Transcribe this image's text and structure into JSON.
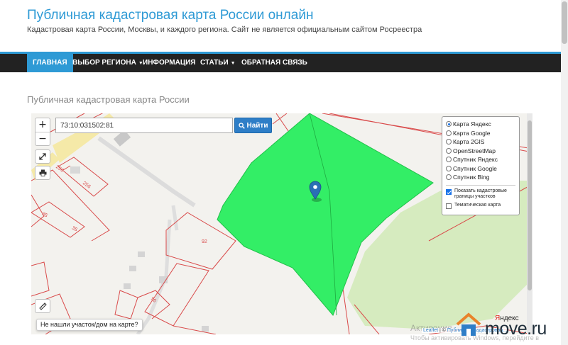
{
  "header": {
    "title": "Публичная кадастровая карта России онлайн",
    "description": "Кадастровая карта России, Москвы, и каждого региона. Сайт не является официальным сайтом Росреестра"
  },
  "nav": {
    "items": [
      {
        "label": "ГЛАВНАЯ",
        "active": true
      },
      {
        "label": "ВЫБОР РЕГИОНА",
        "dropdown": true
      },
      {
        "label": "ИНФОРМАЦИЯ"
      },
      {
        "label": "СТАТЬИ",
        "dropdown": true
      },
      {
        "label": "ОБРАТНАЯ СВЯЗЬ"
      }
    ]
  },
  "section_title": "Публичная кадастровая карта России",
  "map": {
    "zoom_in": "+",
    "zoom_out": "−",
    "search": {
      "value": "73:10:031502:81",
      "button_label": "Найти",
      "button_icon": "search-icon"
    },
    "layers": [
      {
        "label": "Карта Яндекс",
        "selected": true
      },
      {
        "label": "Карта Google",
        "selected": false
      },
      {
        "label": "Карта 2GIS",
        "selected": false
      },
      {
        "label": "OpenStreetMap",
        "selected": false
      },
      {
        "label": "Спутник Яндекс",
        "selected": false
      },
      {
        "label": "Спутник Google",
        "selected": false
      },
      {
        "label": "Спутник Bing",
        "selected": false
      }
    ],
    "overlays": [
      {
        "label": "Показать кадастровые границы участков",
        "checked": true
      },
      {
        "label": "Тематическая карта",
        "checked": false
      }
    ],
    "parcel_labels": [
      "256",
      "256",
      "35",
      "35",
      "92",
      "96"
    ],
    "tooltip": "Не нашли участок/дом на карте?",
    "attribution": {
      "leaflet": "Leaflet",
      "sep": " | © ",
      "rest": "Публичная кадастровая..."
    },
    "yandex_logo": {
      "first": "Я",
      "rest": "ндекс"
    },
    "colors": {
      "parcel_fill": "#33ee66",
      "parcel_border": "#d94a4a",
      "marker": "#2a6fb5",
      "forest": "#d6ebbf",
      "road": "#f5e9a8"
    }
  },
  "overlay_text": {
    "activation": "Активация",
    "activation_sub": "Чтобы активировать Windows, перейдите в"
  },
  "watermark": {
    "text": "move.ru"
  }
}
